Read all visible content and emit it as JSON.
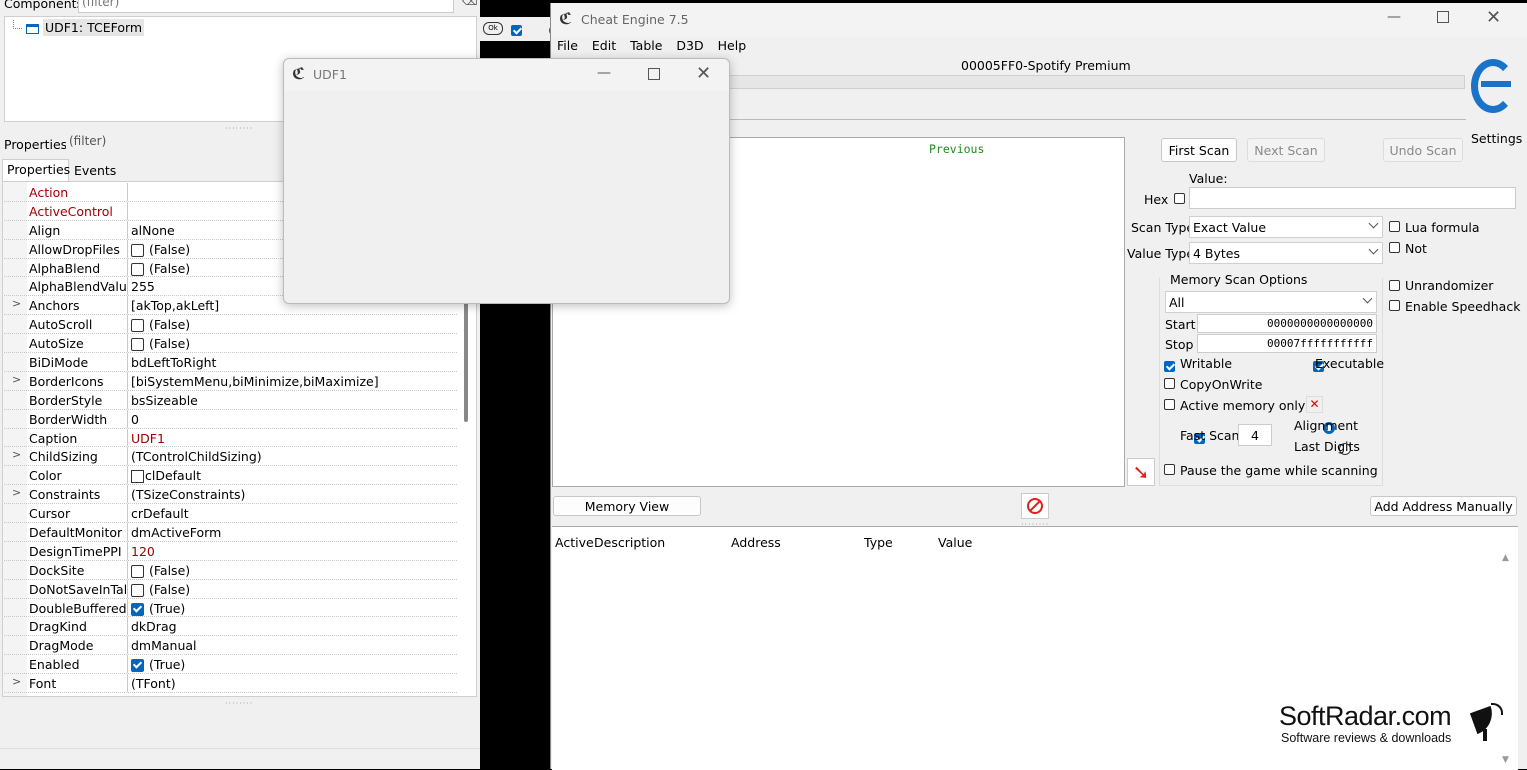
{
  "left_panel": {
    "components_label": "Components",
    "components_filter_placeholder": "(filter)",
    "tree_item": "UDF1: TCEForm",
    "properties_label": "Properties",
    "properties_filter_placeholder": "(filter)",
    "tabs": [
      "Properties",
      "Events"
    ],
    "properties": [
      {
        "name": "Action",
        "value": "",
        "type": "text",
        "name_color": "red"
      },
      {
        "name": "ActiveControl",
        "value": "",
        "type": "text",
        "name_color": "red"
      },
      {
        "name": "Align",
        "value": "alNone",
        "type": "text"
      },
      {
        "name": "AllowDropFiles",
        "value": "(False)",
        "type": "check",
        "checked": false
      },
      {
        "name": "AlphaBlend",
        "value": "(False)",
        "type": "check",
        "checked": false
      },
      {
        "name": "AlphaBlendValue",
        "value": "255",
        "type": "text"
      },
      {
        "name": "Anchors",
        "value": "[akTop,akLeft]",
        "type": "text",
        "expandable": true
      },
      {
        "name": "AutoScroll",
        "value": "(False)",
        "type": "check",
        "checked": false
      },
      {
        "name": "AutoSize",
        "value": "(False)",
        "type": "check",
        "checked": false
      },
      {
        "name": "BiDiMode",
        "value": "bdLeftToRight",
        "type": "text"
      },
      {
        "name": "BorderIcons",
        "value": "[biSystemMenu,biMinimize,biMaximize]",
        "type": "text",
        "expandable": true
      },
      {
        "name": "BorderStyle",
        "value": "bsSizeable",
        "type": "text"
      },
      {
        "name": "BorderWidth",
        "value": "0",
        "type": "text"
      },
      {
        "name": "Caption",
        "value": "UDF1",
        "type": "text",
        "value_color": "red"
      },
      {
        "name": "ChildSizing",
        "value": "(TControlChildSizing)",
        "type": "text",
        "expandable": true
      },
      {
        "name": "Color",
        "value": "clDefault",
        "type": "color"
      },
      {
        "name": "Constraints",
        "value": "(TSizeConstraints)",
        "type": "text",
        "expandable": true
      },
      {
        "name": "Cursor",
        "value": "crDefault",
        "type": "text"
      },
      {
        "name": "DefaultMonitor",
        "value": "dmActiveForm",
        "type": "text"
      },
      {
        "name": "DesignTimePPI",
        "value": "120",
        "type": "text",
        "value_color": "red"
      },
      {
        "name": "DockSite",
        "value": "(False)",
        "type": "check",
        "checked": false
      },
      {
        "name": "DoNotSaveInTabl",
        "value": "(False)",
        "type": "check",
        "checked": false
      },
      {
        "name": "DoubleBuffered",
        "value": "(True)",
        "type": "check",
        "checked": true
      },
      {
        "name": "DragKind",
        "value": "dkDrag",
        "type": "text"
      },
      {
        "name": "DragMode",
        "value": "dmManual",
        "type": "text"
      },
      {
        "name": "Enabled",
        "value": "(True)",
        "type": "check",
        "checked": true
      },
      {
        "name": "Font",
        "value": "(TFont)",
        "type": "text",
        "expandable": true
      }
    ]
  },
  "udf_window": {
    "title": "UDF1"
  },
  "ce": {
    "title": "Cheat Engine 7.5",
    "menu": [
      "File",
      "Edit",
      "Table",
      "D3D",
      "Help"
    ],
    "process": "00005FF0-Spotify Premium",
    "settings_label": "Settings",
    "results_header_previous": "Previous",
    "first_scan": "First Scan",
    "next_scan": "Next Scan",
    "undo_scan": "Undo Scan",
    "value_label": "Value:",
    "hex_label": "Hex",
    "scan_type_label": "Scan Type",
    "scan_type_value": "Exact Value",
    "value_type_label": "Value Type",
    "value_type_value": "4 Bytes",
    "lua_formula": "Lua formula",
    "not_label": "Not",
    "memory_scan_options": "Memory Scan Options",
    "region_value": "All",
    "start_label": "Start",
    "start_value": "0000000000000000",
    "stop_label": "Stop",
    "stop_value": "00007fffffffffff",
    "writable": "Writable",
    "executable": "Executable",
    "copy_on_write": "CopyOnWrite",
    "active_memory_only": "Active memory only",
    "fast_scan": "Fast Scan",
    "fast_scan_value": "4",
    "alignment": "Alignment",
    "last_digits": "Last Digits",
    "pause_game": "Pause the game while scanning",
    "unrandomizer": "Unrandomizer",
    "enable_speedhack": "Enable Speedhack",
    "memory_view": "Memory View",
    "add_address_manually": "Add Address Manually",
    "columns": [
      "Active",
      "Description",
      "Address",
      "Type",
      "Value"
    ]
  },
  "watermark": {
    "brand": "SoftRadar.com",
    "tagline": "Software reviews & downloads"
  },
  "colors": {
    "accent": "#0067c0",
    "red_text": "#a00000",
    "previous_green": "#1e8c1e"
  }
}
